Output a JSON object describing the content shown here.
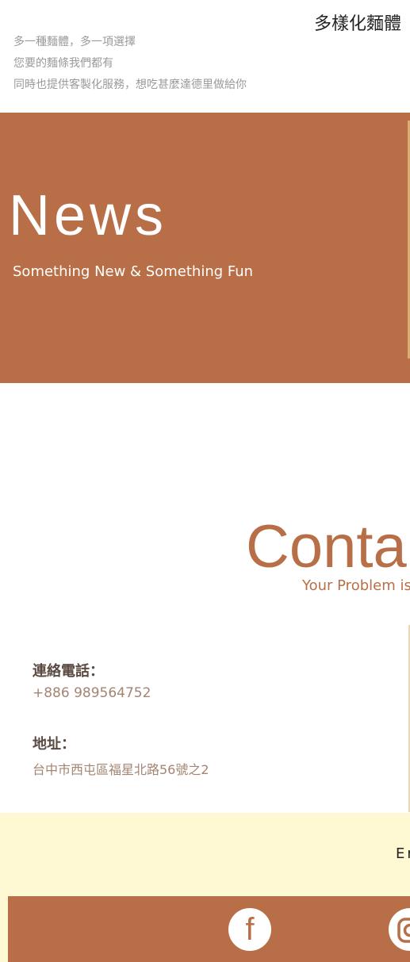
{
  "header": {
    "title": "多樣化麵體",
    "lines": [
      "多一種麵體，多一項選擇",
      "您要的麵條我們都有",
      "同時也提供客製化服務，想吃甚麼達德里做給你"
    ]
  },
  "news": {
    "title": "News",
    "subtitle": "Something New & Something Fun"
  },
  "contact": {
    "title": "Conta",
    "subtitle": "Your Problem is",
    "phone_label": "連絡電話：",
    "phone_value": "+886 989564752",
    "address_label": "地址：",
    "address_value": "台中市西屯區福星北路56號之2"
  },
  "footer": {
    "email_fragment": "Er"
  },
  "social": {
    "facebook_glyph": "f",
    "icons": [
      "facebook-icon",
      "instagram-icon"
    ]
  },
  "colors": {
    "brand_brown": "#b86f47",
    "cream": "#fef8d3",
    "muted_text": "#9a9a9a"
  }
}
